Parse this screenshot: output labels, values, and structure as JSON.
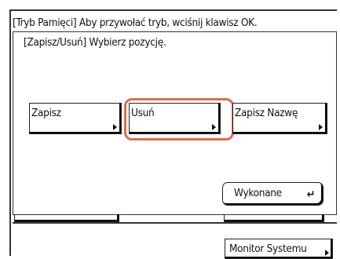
{
  "header": {
    "title": "[Tryb Pamięci] Aby przywołać tryb, wciśnij klawisz OK."
  },
  "dialog": {
    "subtitle": "[Zapisz/Usuń] Wybierz pozycję.",
    "buttons": {
      "save": "Zapisz",
      "delete": "Usuń",
      "save_name": "Zapisz Nazwę"
    },
    "done_label": "Wykonane",
    "done_icon": "return-arrow-icon"
  },
  "footer": {
    "monitor_label": "Monitor Systemu"
  },
  "colors": {
    "highlight": "#e06b52"
  }
}
